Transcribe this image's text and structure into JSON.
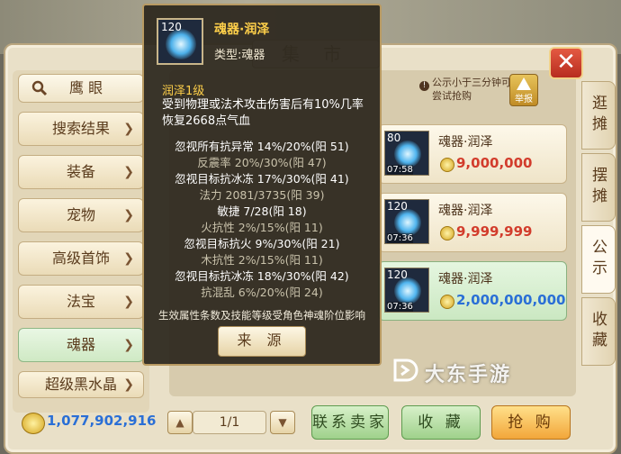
{
  "market": {
    "title": "集 市"
  },
  "left_menu": {
    "search_label": "鹰 眼",
    "items": [
      {
        "label": "搜索结果"
      },
      {
        "label": "装备"
      },
      {
        "label": "宠物"
      },
      {
        "label": "高级首饰"
      },
      {
        "label": "法宝"
      },
      {
        "label": "魂器"
      },
      {
        "label": "超级黑水晶"
      }
    ],
    "active_index": 5
  },
  "right_tabs": [
    {
      "label": "逛摊"
    },
    {
      "label": "摆摊"
    },
    {
      "label": "公示"
    },
    {
      "label": "收藏"
    }
  ],
  "notice": {
    "text": "公示小于三分钟可尝试抢购",
    "report_label": "举报"
  },
  "listings": [
    {
      "level": "80",
      "time": "07:58",
      "name": "魂器·润泽",
      "price": "9,000,000",
      "price_color": "#d23c2c"
    },
    {
      "level": "120",
      "time": "07:36",
      "name": "魂器·润泽",
      "price": "9,999,999",
      "price_color": "#d23c2c"
    },
    {
      "level": "120",
      "time": "07:36",
      "name": "魂器·润泽",
      "price": "2,000,000,000",
      "price_color": "#2a6fd6",
      "selected": true
    }
  ],
  "tooltip": {
    "level": "120",
    "name": "魂器·润泽",
    "type": "类型:魂器",
    "skill_title": "润泽1级",
    "skill_desc": "受到物理或法术攻击伤害后有10%几率恢复2668点气血",
    "attributes": [
      {
        "text": "忽视所有抗异常 14%/20%(阳 51)",
        "color": "#ffffff"
      },
      {
        "text": "反震率 20%/30%(阳 47)",
        "color": "#c9c2ab"
      },
      {
        "text": "忽视目标抗冰冻 17%/30%(阳 41)",
        "color": "#ffffff"
      },
      {
        "text": "法力 2081/3735(阳 39)",
        "color": "#c9c2ab"
      },
      {
        "text": "敏捷 7/28(阳 18)",
        "color": "#ffffff"
      },
      {
        "text": "火抗性 2%/15%(阳 11)",
        "color": "#c9c2ab"
      },
      {
        "text": "忽视目标抗火 9%/30%(阳 21)",
        "color": "#ffffff"
      },
      {
        "text": "木抗性 2%/15%(阳 11)",
        "color": "#c9c2ab"
      },
      {
        "text": "忽视目标抗冰冻 18%/30%(阳 42)",
        "color": "#ffffff"
      },
      {
        "text": "抗混乱 6%/20%(阳 24)",
        "color": "#c9c2ab"
      }
    ],
    "footer": "生效属性条数及技能等级受角色神魂阶位影响",
    "source_button": "来 源"
  },
  "bottom": {
    "money": "1,077,902,916",
    "page": "1/1",
    "contact_button": "联系卖家",
    "favorite_button": "收 藏",
    "buy_button": "抢 购"
  },
  "watermark": {
    "text": "大东手游"
  }
}
